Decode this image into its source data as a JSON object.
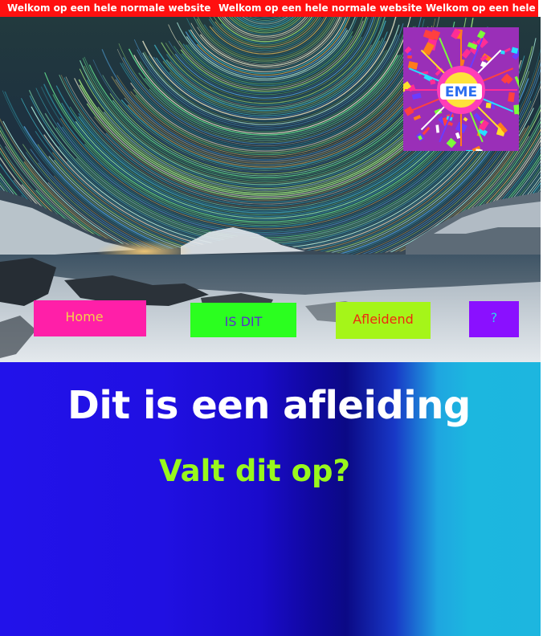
{
  "banner": {
    "messages": [
      "Welkom op een hele normale website",
      "Welkom op een hele normale website",
      "Welkom op een hele"
    ]
  },
  "sticker": {
    "text": "EME"
  },
  "nav": {
    "items": [
      {
        "label": "Home",
        "bg": "#ff1fa8",
        "color": "#f6d04a"
      },
      {
        "label": "IS DIT",
        "bg": "#2bff1f",
        "color": "#5633c8"
      },
      {
        "label": "Afleidend",
        "bg": "#a5f519",
        "color": "#ee2a10"
      },
      {
        "label": "?",
        "bg": "#8a10ff",
        "color": "#2ed3ee"
      }
    ]
  },
  "main": {
    "headline": "Dit is een afleiding",
    "subline": "Valt dit op?"
  },
  "colors": {
    "banner": "#ff1010",
    "headline": "#ffffff",
    "subline": "#99f81c"
  }
}
